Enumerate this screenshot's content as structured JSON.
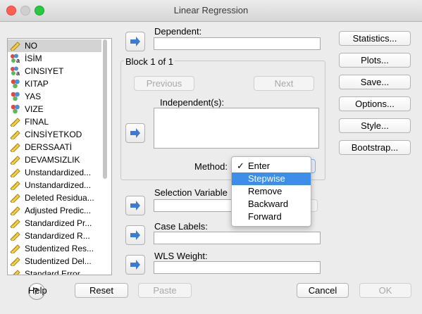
{
  "window": {
    "title": "Linear Regression"
  },
  "colors": {
    "close": "#ff5f57",
    "minimize": "#febc2e",
    "zoom": "#28c840",
    "highlight": "#3d8ee8",
    "arrow": "#3a7bd5"
  },
  "variables": [
    {
      "name": "NO",
      "icon": "scale-ruler-icon",
      "selected": true
    },
    {
      "name": "İSİM",
      "icon": "nominal-text-icon"
    },
    {
      "name": "CINSIYET",
      "icon": "nominal-text-icon"
    },
    {
      "name": "KITAP",
      "icon": "nominal-icon"
    },
    {
      "name": "YAS",
      "icon": "nominal-icon"
    },
    {
      "name": "VIZE",
      "icon": "nominal-icon"
    },
    {
      "name": "FINAL",
      "icon": "scale-ruler-icon"
    },
    {
      "name": "CİNSİYETKOD",
      "icon": "scale-ruler-icon"
    },
    {
      "name": "DERSSAATİ",
      "icon": "scale-ruler-icon"
    },
    {
      "name": "DEVAMSIZLIK",
      "icon": "scale-ruler-icon"
    },
    {
      "name": "Unstandardized...",
      "icon": "scale-ruler-icon"
    },
    {
      "name": "Unstandardized...",
      "icon": "scale-ruler-icon"
    },
    {
      "name": "Deleted Residua...",
      "icon": "scale-ruler-icon"
    },
    {
      "name": "Adjusted Predic...",
      "icon": "scale-ruler-icon"
    },
    {
      "name": "Standardized Pr...",
      "icon": "scale-ruler-icon"
    },
    {
      "name": "Standardized R...",
      "icon": "scale-ruler-icon"
    },
    {
      "name": "Studentized Res...",
      "icon": "scale-ruler-icon"
    },
    {
      "name": "Studentized Del...",
      "icon": "scale-ruler-icon"
    },
    {
      "name": "Standard Error...",
      "icon": "scale-ruler-icon"
    }
  ],
  "dependent": {
    "label": "Dependent:",
    "value": ""
  },
  "block": {
    "label": "Block 1 of 1",
    "previous": "Previous",
    "next": "Next"
  },
  "independents": {
    "label": "Independent(s):"
  },
  "method": {
    "label": "Method:",
    "selected": "Enter",
    "options": [
      "Enter",
      "Stepwise",
      "Remove",
      "Backward",
      "Forward"
    ],
    "highlighted": "Stepwise"
  },
  "selection_variable": {
    "label": "Selection Variable"
  },
  "case_labels": {
    "label": "Case Labels:"
  },
  "wls_weight": {
    "label": "WLS Weight:"
  },
  "side_buttons": [
    "Statistics...",
    "Plots...",
    "Save...",
    "Options...",
    "Style...",
    "Bootstrap..."
  ],
  "footer": {
    "help": "Help",
    "reset": "Reset",
    "paste": "Paste",
    "cancel": "Cancel",
    "ok": "OK"
  }
}
